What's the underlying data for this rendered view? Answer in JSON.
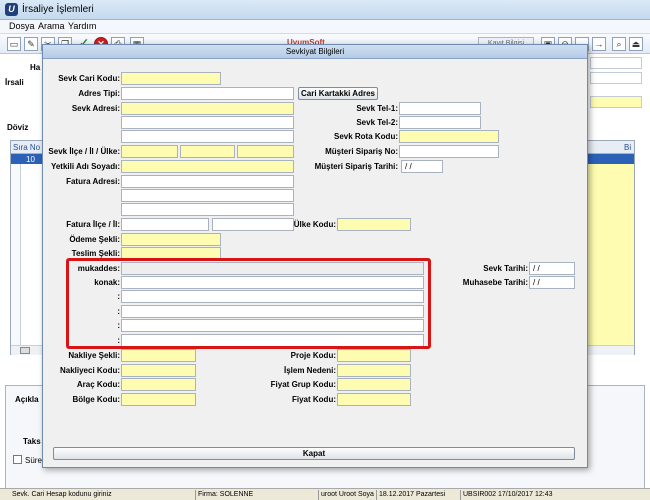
{
  "window": {
    "title": "İrsaliye  İşlemleri",
    "app_icon_glyph": "U"
  },
  "menu": [
    "Dosya",
    "Arama",
    "Yardım"
  ],
  "toolbar": {
    "brand_text": "UyumSoft",
    "kayit_text": "Kayıt Bilgisi"
  },
  "background_form": {
    "label_ha": "Ha",
    "label_irsali": "İrsali",
    "label_doviz": "Döviz",
    "grid_col_sira": "Sıra No",
    "grid_col_bi": "Bi",
    "grid_row_no": "10",
    "label_aciklama": "Açıkla",
    "label_taksit": "Taks",
    "label_sureli": "Süre"
  },
  "dialog": {
    "title": "Sevkiyat Bilgileri",
    "labels": {
      "sevk_cari_kodu": "Sevk Cari Kodu:",
      "adres_tipi": "Adres Tipi:",
      "sevk_adresi": "Sevk Adresi:",
      "sevk_ilce_il_ulke": "Sevk İlçe / İl / Ülke:",
      "yetkili_adi_soyadi": "Yetkili Adı Soyadı:",
      "fatura_adresi": "Fatura  Adresi:",
      "fatura_ilce_il": "Fatura İlçe / İl:",
      "odeme_sekli": "Ödeme Şekli:",
      "teslim_sekli": "Teslim Şekli:",
      "mukaddes": "mukaddes:",
      "konak": "konak:",
      "colon1": ":",
      "colon2": ":",
      "colon3": ":",
      "sevk_tel_1": "Sevk Tel-1:",
      "sevk_tel_2": "Sevk Tel-2:",
      "sevk_rota_kodu": "Sevk Rota Kodu:",
      "musteri_siparis_no": "Müşteri Sipariş No:",
      "musteri_siparis_tarihi": "Müşteri Sipariş Tarihi:",
      "ulke_kodu": "Ülke Kodu:",
      "sevk_tarihi": "Sevk Tarihi:",
      "muhasebe_tarihi": "Muhasebe Tarihi:",
      "nakliye_sekli": "Nakliye Şekli:",
      "nakliyeci_kodu": "Nakliyeci Kodu:",
      "arac_kodu": "Araç Kodu:",
      "bolge_kodu": "Bölge Kodu:",
      "proje_kodu": "Proje Kodu:",
      "islem_nedeni": "İşlem Nedeni:",
      "fiyat_grup_kodu": "Fiyat Grup Kodu:",
      "fiyat_kodu": "Fiyat Kodu:"
    },
    "values": {
      "musteri_siparis_tarihi": " / /",
      "sevk_tarihi": " / /",
      "muhasebe_tarihi": " / /"
    },
    "buttons": {
      "cari_kartaki_adres": "Cari Kartakki Adres",
      "kapat": "Kapat"
    }
  },
  "statusbar": {
    "hint": "Sevk. Cari Hesap kodunu giriniz",
    "firma": "Firma: SOLENNE",
    "user": "uroot Uroot Soyadı",
    "date": "18.12.2017  Pazartesi",
    "version": "UBSIR002 17/10/2017 12:43"
  },
  "colors": {
    "field_yellow": "#fdfcb0",
    "highlight_red": "#d81414",
    "grid_selection": "#2c61b8"
  }
}
